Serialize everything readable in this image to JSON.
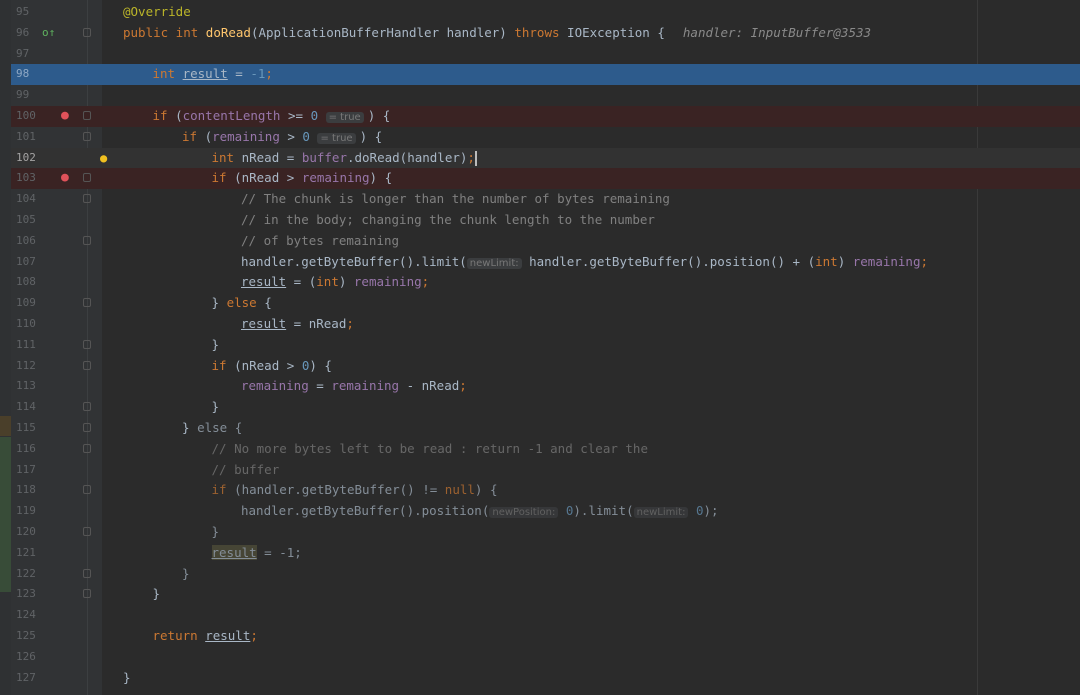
{
  "editor": {
    "colors": {
      "background": "#2b2b2b",
      "execution_line": "#2d5b8c",
      "breakpoint_line": "#3a2323",
      "keyword": "#cc7832",
      "method": "#ffc66d",
      "field": "#9876aa",
      "number": "#6897bb",
      "comment": "#808080",
      "annotation": "#bbb529"
    },
    "gutter_icons": {
      "override": "override-up-arrow-icon",
      "breakpoint": "breakpoint-verified-icon",
      "intention": "lightbulb-icon"
    },
    "lines": [
      {
        "num": "95",
        "indent": 0,
        "segs": [
          {
            "t": "@Override",
            "c": "ann"
          }
        ]
      },
      {
        "num": "96",
        "indent": 0,
        "gutter": "override",
        "segs": [
          {
            "t": "public int ",
            "c": "k"
          },
          {
            "t": "doRead",
            "c": "f"
          },
          {
            "t": "(ApplicationBufferHandler handler) "
          },
          {
            "t": "throws ",
            "c": "k"
          },
          {
            "t": "IOException {"
          }
        ],
        "debug": "handler: InputBuffer@3533"
      },
      {
        "num": "97",
        "indent": 0,
        "segs": []
      },
      {
        "num": "98",
        "indent": 1,
        "state": "exec",
        "segs": [
          {
            "t": "int ",
            "c": "k"
          },
          {
            "t": "result",
            "c": "u"
          },
          {
            "t": " = "
          },
          {
            "t": "-1",
            "c": "n"
          },
          {
            "t": ";",
            "c": "k"
          }
        ]
      },
      {
        "num": "99",
        "indent": 0,
        "segs": []
      },
      {
        "num": "100",
        "indent": 1,
        "state": "bp",
        "gutter": "breakpoint",
        "segs": [
          {
            "t": "if ",
            "c": "k"
          },
          {
            "t": "("
          },
          {
            "t": "contentLength",
            "c": "v"
          },
          {
            "t": " >= "
          },
          {
            "t": "0",
            "c": "n"
          },
          {
            "t": " "
          },
          {
            "hint": "= true"
          },
          {
            "t": ") {"
          }
        ]
      },
      {
        "num": "101",
        "indent": 2,
        "segs": [
          {
            "t": "if ",
            "c": "k"
          },
          {
            "t": "("
          },
          {
            "t": "remaining",
            "c": "v"
          },
          {
            "t": " > "
          },
          {
            "t": "0",
            "c": "n"
          },
          {
            "t": " "
          },
          {
            "hint": "= true"
          },
          {
            "t": ") {"
          }
        ]
      },
      {
        "num": "102",
        "indent": 3,
        "state": "current",
        "gutter": "intention",
        "segs": [
          {
            "t": "int ",
            "c": "k"
          },
          {
            "t": "nRead = "
          },
          {
            "t": "buffer",
            "c": "v"
          },
          {
            "t": ".doRead(handler)"
          },
          {
            "t": ";",
            "c": "k"
          },
          {
            "caret": true
          }
        ]
      },
      {
        "num": "103",
        "indent": 3,
        "state": "bp",
        "gutter": "breakpoint",
        "segs": [
          {
            "t": "if ",
            "c": "k"
          },
          {
            "t": "(nRead > "
          },
          {
            "t": "remaining",
            "c": "v"
          },
          {
            "t": ") {"
          }
        ]
      },
      {
        "num": "104",
        "indent": 4,
        "segs": [
          {
            "t": "// The chunk is longer than the number of bytes remaining",
            "c": "c"
          }
        ]
      },
      {
        "num": "105",
        "indent": 4,
        "segs": [
          {
            "t": "// in the body; changing the chunk length to the number",
            "c": "c"
          }
        ]
      },
      {
        "num": "106",
        "indent": 4,
        "segs": [
          {
            "t": "// of bytes remaining",
            "c": "c"
          }
        ]
      },
      {
        "num": "107",
        "indent": 4,
        "segs": [
          {
            "t": "handler.getByteBuffer().limit("
          },
          {
            "inlay": "newLimit:"
          },
          {
            "t": " handler.getByteBuffer().position() + ("
          },
          {
            "t": "int",
            "c": "k"
          },
          {
            "t": ") "
          },
          {
            "t": "remaining",
            "c": "v"
          },
          {
            "t": ";",
            "c": "k"
          }
        ]
      },
      {
        "num": "108",
        "indent": 4,
        "segs": [
          {
            "t": "result",
            "c": "u"
          },
          {
            "t": " = ("
          },
          {
            "t": "int",
            "c": "k"
          },
          {
            "t": ") "
          },
          {
            "t": "remaining",
            "c": "v"
          },
          {
            "t": ";",
            "c": "k"
          }
        ]
      },
      {
        "num": "109",
        "indent": 3,
        "segs": [
          {
            "t": "} "
          },
          {
            "t": "else ",
            "c": "k"
          },
          {
            "t": "{"
          }
        ]
      },
      {
        "num": "110",
        "indent": 4,
        "segs": [
          {
            "t": "result",
            "c": "u"
          },
          {
            "t": " = nRead"
          },
          {
            "t": ";",
            "c": "k"
          }
        ]
      },
      {
        "num": "111",
        "indent": 3,
        "segs": [
          {
            "t": "}"
          }
        ]
      },
      {
        "num": "112",
        "indent": 3,
        "segs": [
          {
            "t": "if ",
            "c": "k"
          },
          {
            "t": "(nRead > "
          },
          {
            "t": "0",
            "c": "n"
          },
          {
            "t": ") {"
          }
        ]
      },
      {
        "num": "113",
        "indent": 4,
        "segs": [
          {
            "t": "remaining",
            "c": "v"
          },
          {
            "t": " = "
          },
          {
            "t": "remaining",
            "c": "v"
          },
          {
            "t": " - nRead"
          },
          {
            "t": ";",
            "c": "k"
          }
        ]
      },
      {
        "num": "114",
        "indent": 3,
        "segs": [
          {
            "t": "}"
          }
        ]
      },
      {
        "num": "115",
        "indent": 2,
        "segs": [
          {
            "t": "} "
          },
          {
            "t": "else {",
            "c": "dim"
          }
        ]
      },
      {
        "num": "116",
        "indent": 3,
        "dim": true,
        "segs": [
          {
            "t": "// No more bytes left to be read : return -1 and clear the",
            "c": "c"
          }
        ]
      },
      {
        "num": "117",
        "indent": 3,
        "dim": true,
        "segs": [
          {
            "t": "// buffer",
            "c": "c"
          }
        ]
      },
      {
        "num": "118",
        "indent": 3,
        "dim": true,
        "segs": [
          {
            "t": "if ",
            "c": "k"
          },
          {
            "t": "(handler.getByteBuffer() != "
          },
          {
            "t": "null",
            "c": "k"
          },
          {
            "t": ") {"
          }
        ]
      },
      {
        "num": "119",
        "indent": 4,
        "dim": true,
        "segs": [
          {
            "t": "handler.getByteBuffer().position("
          },
          {
            "inlay": "newPosition:"
          },
          {
            "t": " "
          },
          {
            "t": "0",
            "c": "n"
          },
          {
            "t": ").limit("
          },
          {
            "inlay": "newLimit:"
          },
          {
            "t": " "
          },
          {
            "t": "0",
            "c": "n"
          },
          {
            "t": ");"
          }
        ]
      },
      {
        "num": "120",
        "indent": 3,
        "dim": true,
        "segs": [
          {
            "t": "}"
          }
        ]
      },
      {
        "num": "121",
        "indent": 3,
        "dim": true,
        "segs": [
          {
            "t": "result",
            "c": "uhl"
          },
          {
            "t": " = -1;"
          }
        ]
      },
      {
        "num": "122",
        "indent": 2,
        "dim": true,
        "segs": [
          {
            "t": "}"
          }
        ]
      },
      {
        "num": "123",
        "indent": 1,
        "segs": [
          {
            "t": "}"
          }
        ]
      },
      {
        "num": "124",
        "indent": 0,
        "segs": []
      },
      {
        "num": "125",
        "indent": 1,
        "segs": [
          {
            "t": "return ",
            "c": "k"
          },
          {
            "t": "result",
            "c": "u"
          },
          {
            "t": ";",
            "c": "k"
          }
        ]
      },
      {
        "num": "126",
        "indent": 0,
        "segs": []
      },
      {
        "num": "127",
        "indent": 0,
        "segs": [
          {
            "t": "}"
          }
        ]
      }
    ]
  }
}
